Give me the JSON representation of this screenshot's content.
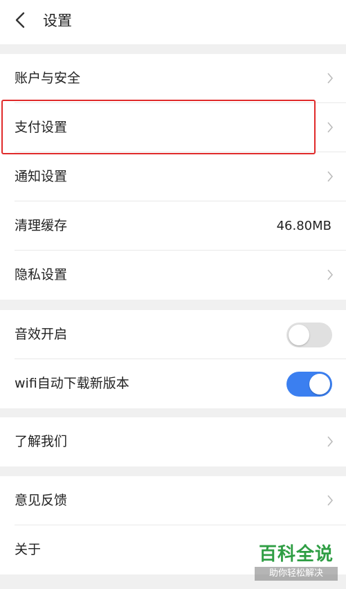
{
  "header": {
    "title": "设置"
  },
  "group1": {
    "items": [
      {
        "label": "账户与安全"
      },
      {
        "label": "支付设置"
      },
      {
        "label": "通知设置"
      },
      {
        "label": "清理缓存",
        "value": "46.80MB"
      },
      {
        "label": "隐私设置"
      }
    ]
  },
  "group2": {
    "items": [
      {
        "label": "音效开启",
        "toggle": false
      },
      {
        "label": "wifi自动下载新版本",
        "toggle": true
      }
    ]
  },
  "group3": {
    "items": [
      {
        "label": "了解我们"
      }
    ]
  },
  "group4": {
    "items": [
      {
        "label": "意见反馈"
      },
      {
        "label": "关于"
      }
    ]
  },
  "watermark": {
    "line1": "百科全说",
    "line2": "助你轻松解决"
  },
  "colors": {
    "toggle_on": "#3b7ff0",
    "toggle_off": "#e0e0e0",
    "highlight": "#e02a2a",
    "watermark": "#2f9e44"
  }
}
